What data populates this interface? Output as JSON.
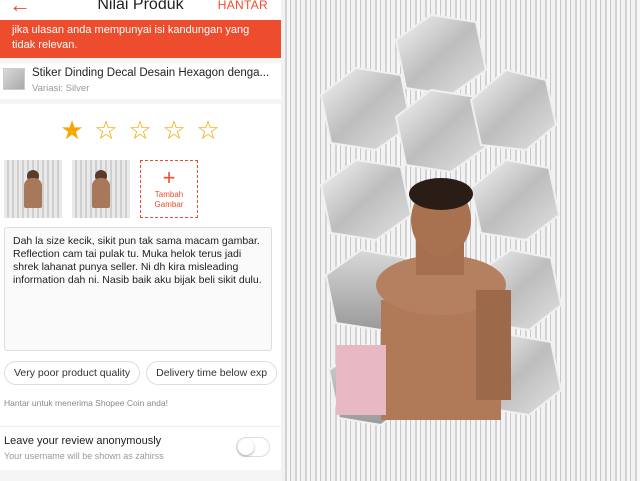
{
  "header": {
    "back_icon": "arrow-left-icon",
    "title": "Nilai Produk",
    "submit_label": "HANTAR"
  },
  "warning": {
    "text": "jika ulasan anda mempunyai isi kandungan yang tidak relevan."
  },
  "product": {
    "name": "Stiker Dinding Decal Desain Hexagon denga...",
    "variation": "Variasi: Silver"
  },
  "rating": {
    "value": 1,
    "max": 5,
    "star_color": "#f6a700"
  },
  "photos": {
    "add_label": "Tambah Gambar",
    "add_icon": "plus-icon"
  },
  "review": {
    "text": "Dah la size kecik, sikit pun tak sama macam gambar. Reflection cam tai pulak tu. Muka helok terus jadi shrek lahanat punya seller. Ni dh kira misleading information dah ni. Nasib baik aku bijak beli sikit dulu."
  },
  "chips": [
    "Very poor product quality",
    "Delivery time below exp"
  ],
  "coin_hint": "Hantar untuk menerima Shopee Coin anda!",
  "anonymous": {
    "title": "Leave your review anonymously",
    "subtitle": "Your username will be shown as zahirss",
    "enabled": false
  },
  "colors": {
    "accent": "#ee4d2d"
  }
}
